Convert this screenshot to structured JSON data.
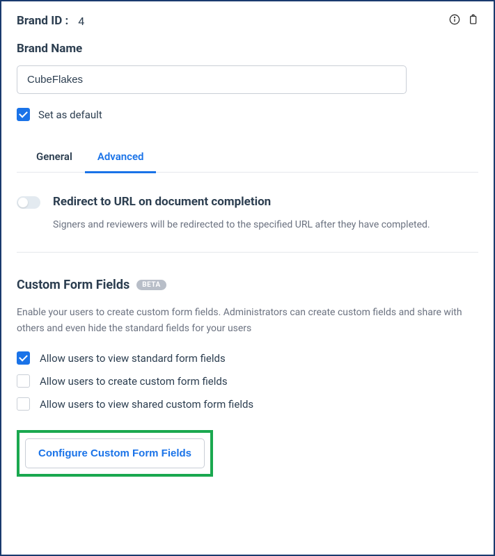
{
  "brandId": {
    "label": "Brand ID :",
    "value": "4"
  },
  "brandName": {
    "label": "Brand Name",
    "value": "CubeFlakes"
  },
  "setDefault": {
    "label": "Set as default",
    "checked": true
  },
  "tabs": {
    "general": "General",
    "advanced": "Advanced"
  },
  "redirect": {
    "title": "Redirect to URL on document completion",
    "desc": "Signers and reviewers will be redirected to the specified URL after they have completed.",
    "enabled": false
  },
  "customFields": {
    "title": "Custom Form Fields",
    "badge": "BETA",
    "desc": "Enable your users to create custom form fields. Administrators can create custom fields and share with others and even hide the standard fields for your users",
    "options": [
      {
        "label": "Allow users to view standard form fields",
        "checked": true
      },
      {
        "label": "Allow users to create custom form fields",
        "checked": false
      },
      {
        "label": "Allow users to view shared custom form fields",
        "checked": false
      }
    ],
    "configureButton": "Configure Custom Form Fields"
  }
}
